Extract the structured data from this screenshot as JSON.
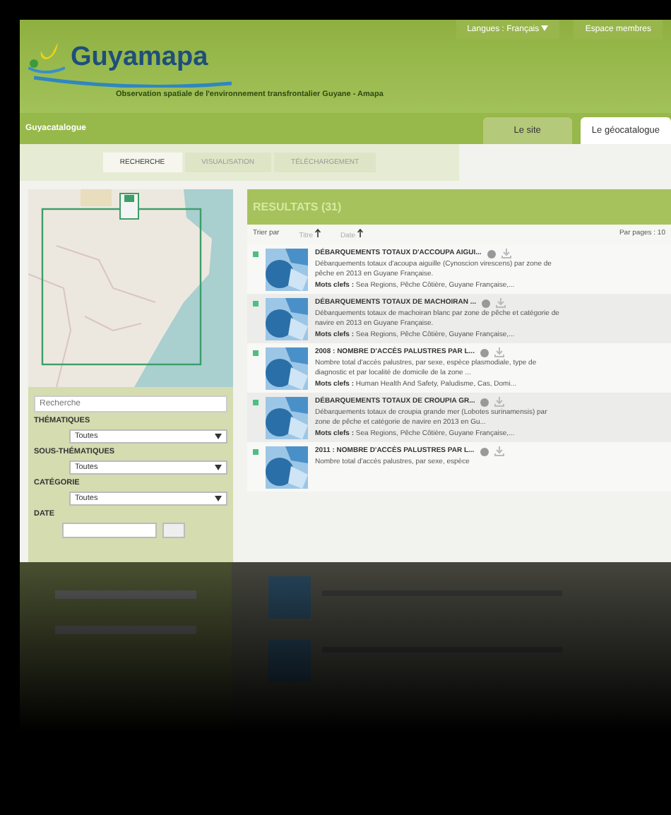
{
  "header": {
    "logo": "Guyamapa",
    "tagline": "Observation spatiale de l'environnement transfrontalier Guyane - Amapa",
    "language_label": "Langues :",
    "language_value": "Français",
    "members": "Espace membres"
  },
  "nav": {
    "section": "Guyacatalogue",
    "tabs": [
      {
        "label": "Le site",
        "selected": false
      },
      {
        "label": "Le géocatalogue",
        "selected": true
      }
    ]
  },
  "steps": [
    {
      "label": "RECHERCHE",
      "selected": true
    },
    {
      "label": "VISUALISATION",
      "selected": false
    },
    {
      "label": "TÉLÉCHARGEMENT",
      "selected": false
    }
  ],
  "filters": {
    "search_placeholder": "Recherche",
    "groups": [
      {
        "label": "THÉMATIQUES",
        "value": "Toutes"
      },
      {
        "label": "SOUS-THÉMATIQUES",
        "value": "Toutes"
      },
      {
        "label": "CATÉGORIE",
        "value": "Toutes"
      }
    ],
    "date_label": "DATE"
  },
  "results": {
    "title": "RESULTATS (31)",
    "sort_label": "Trier par",
    "sort_options": [
      "Titre",
      "Date"
    ],
    "per_page": "Par pages : 10",
    "items": [
      {
        "title": "DÉBARQUEMENTS TOTAUX D'ACCOUPA AIGUI...",
        "description": "Débarquements totaux d'acoupa aiguille (Cynoscion virescens) par zone de pêche en 2013 en Guyane Française.",
        "keywords_label": "Mots clefs :",
        "keywords": "Sea Regions, Pêche Côtière, Guyane Française,..."
      },
      {
        "title": "DÉBARQUEMENTS TOTAUX DE MACHOIRAN ...",
        "description": "Débarquements totaux de machoiran blanc par zone de pêche et catégorie de navire en 2013 en Guyane Française.",
        "keywords_label": "Mots clefs :",
        "keywords": "Sea Regions, Pêche Côtière, Guyane Française,..."
      },
      {
        "title": "2008 : NOMBRE D'ACCÈS PALUSTRES PAR L...",
        "description": "Nombre total d'accès palustres, par sexe, espèce plasmodiale, type de diagnostic et par localité de domicile de la zone ...",
        "keywords_label": "Mots clefs :",
        "keywords": "Human Health And Safety, Paludisme, Cas, Domi..."
      },
      {
        "title": "DÉBARQUEMENTS TOTAUX DE CROUPIA GR...",
        "description": "Débarquements totaux de croupia grande mer (Lobotes surinamensis) par zone de pêche et catégorie de navire en 2013 en Gu...",
        "keywords_label": "Mots clefs :",
        "keywords": "Sea Regions, Pêche Côtière, Guyane Française,..."
      },
      {
        "title": "2011 : NOMBRE D'ACCÈS PALUSTRES PAR L...",
        "description": "Nombre total d'accès palustres, par sexe, espèce"
      }
    ]
  }
}
